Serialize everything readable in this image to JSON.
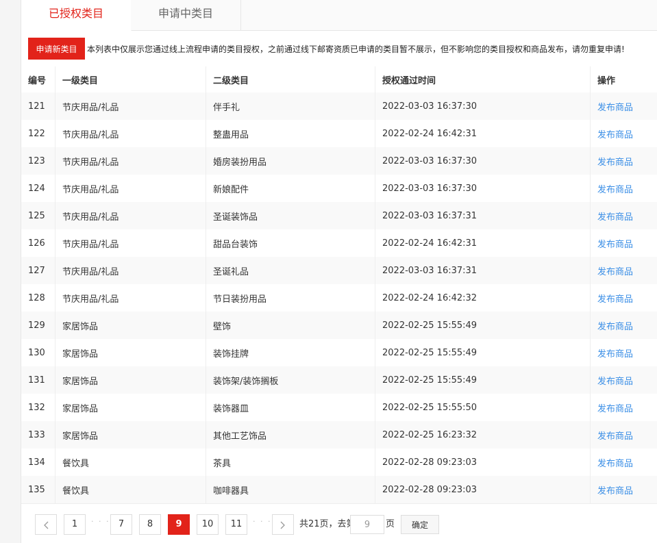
{
  "tabs": {
    "authorized": "已授权类目",
    "applying": "申请中类目"
  },
  "notice": {
    "apply_button": "申请新类目",
    "text": "本列表中仅展示您通过线上流程申请的类目授权，之前通过线下邮寄资质已申请的类目暂不展示，但不影响您的类目授权和商品发布，请勿重复申请!"
  },
  "table": {
    "headers": {
      "no": "编号",
      "level1": "一级类目",
      "level2": "二级类目",
      "time": "授权通过时间",
      "action": "操作"
    },
    "rows": [
      {
        "no": "121",
        "level1": "节庆用品/礼品",
        "level2": "伴手礼",
        "time": "2022-03-03 16:37:30",
        "action": "发布商品"
      },
      {
        "no": "122",
        "level1": "节庆用品/礼品",
        "level2": "整蛊用品",
        "time": "2022-02-24 16:42:31",
        "action": "发布商品"
      },
      {
        "no": "123",
        "level1": "节庆用品/礼品",
        "level2": "婚房装扮用品",
        "time": "2022-03-03 16:37:30",
        "action": "发布商品"
      },
      {
        "no": "124",
        "level1": "节庆用品/礼品",
        "level2": "新娘配件",
        "time": "2022-03-03 16:37:30",
        "action": "发布商品"
      },
      {
        "no": "125",
        "level1": "节庆用品/礼品",
        "level2": "圣诞装饰品",
        "time": "2022-03-03 16:37:31",
        "action": "发布商品"
      },
      {
        "no": "126",
        "level1": "节庆用品/礼品",
        "level2": "甜品台装饰",
        "time": "2022-02-24 16:42:31",
        "action": "发布商品"
      },
      {
        "no": "127",
        "level1": "节庆用品/礼品",
        "level2": "圣诞礼品",
        "time": "2022-03-03 16:37:31",
        "action": "发布商品"
      },
      {
        "no": "128",
        "level1": "节庆用品/礼品",
        "level2": "节日装扮用品",
        "time": "2022-02-24 16:42:32",
        "action": "发布商品"
      },
      {
        "no": "129",
        "level1": "家居饰品",
        "level2": "壁饰",
        "time": "2022-02-25 15:55:49",
        "action": "发布商品"
      },
      {
        "no": "130",
        "level1": "家居饰品",
        "level2": "装饰挂牌",
        "time": "2022-02-25 15:55:49",
        "action": "发布商品"
      },
      {
        "no": "131",
        "level1": "家居饰品",
        "level2": "装饰架/装饰搁板",
        "time": "2022-02-25 15:55:49",
        "action": "发布商品"
      },
      {
        "no": "132",
        "level1": "家居饰品",
        "level2": "装饰器皿",
        "time": "2022-02-25 15:55:50",
        "action": "发布商品"
      },
      {
        "no": "133",
        "level1": "家居饰品",
        "level2": "其他工艺饰品",
        "time": "2022-02-25 16:23:32",
        "action": "发布商品"
      },
      {
        "no": "134",
        "level1": "餐饮具",
        "level2": "茶具",
        "time": "2022-02-28 09:23:03",
        "action": "发布商品"
      },
      {
        "no": "135",
        "level1": "餐饮具",
        "level2": "咖啡器具",
        "time": "2022-02-28 09:23:03",
        "action": "发布商品"
      }
    ]
  },
  "pagination": {
    "pages": [
      "1",
      "7",
      "8",
      "9",
      "10",
      "11"
    ],
    "current": "9",
    "ellipsis": "· · ·",
    "total_text": "共21页，去第",
    "goto_value": "9",
    "page_suffix": "页",
    "confirm": "确定"
  },
  "colors": {
    "accent": "#e2231a",
    "link": "#3a8ee6"
  }
}
